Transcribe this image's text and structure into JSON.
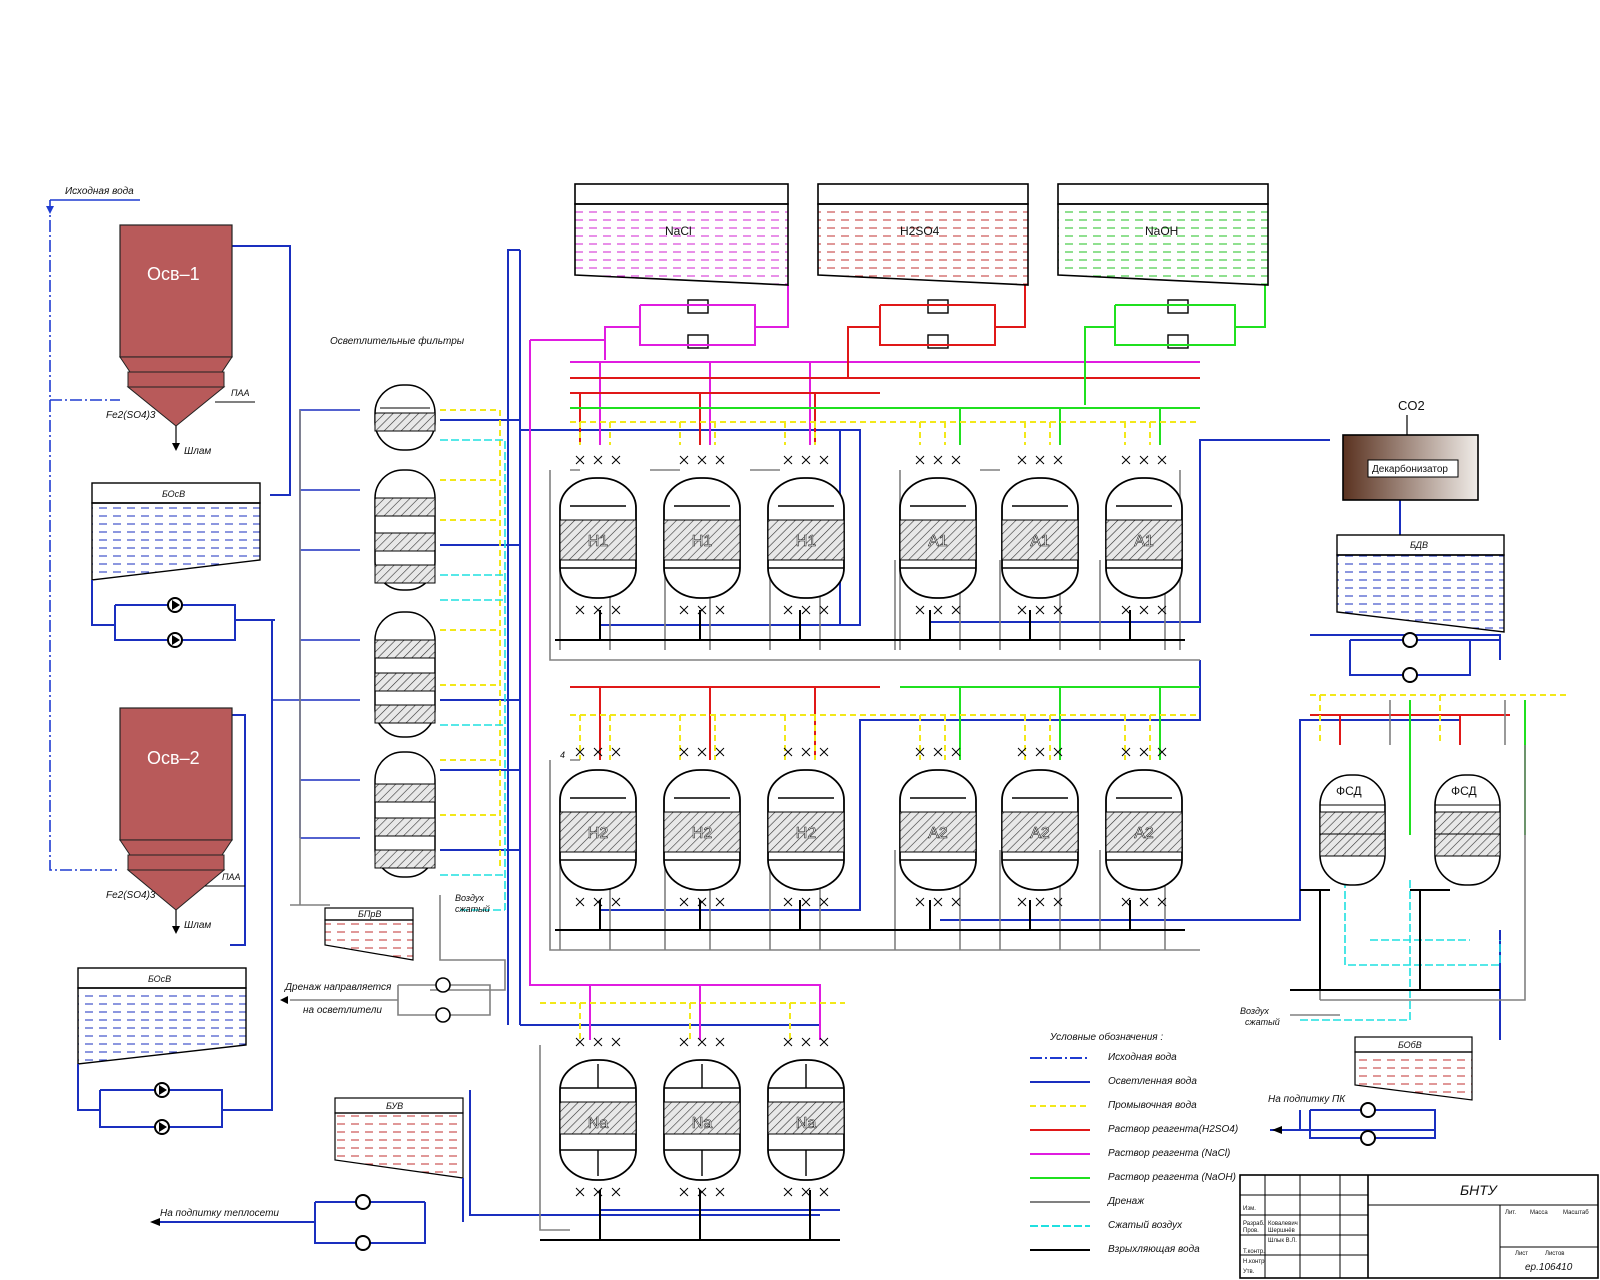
{
  "colors": {
    "source_water": "#1f3bd1",
    "clarified_water": "#1a2fbf",
    "wash_water": "#f2e81a",
    "reagent_h2so4": "#e01818",
    "reagent_nacl": "#e01ce0",
    "reagent_naoh": "#1fe01f",
    "drainage": "#808080",
    "compressed_air": "#1fe0e0",
    "loosening_water": "#000000",
    "clarifier_fill": "#b85a5a",
    "decarb_fill": "#6b4530"
  },
  "labels": {
    "source_water_top": "Исходная вода",
    "clarifier1": "Осв–1",
    "clarifier2": "Осв–2",
    "paa1": "ПАА",
    "paa2": "ПАА",
    "fe1": "Fe2(SO4)3",
    "fe2": "Fe2(SO4)3",
    "sludge1": "Шлам",
    "sludge2": "Шлам",
    "bosv1": "БОсВ",
    "bosv2": "БОсВ",
    "filters_title": "Осветлительные фильтры",
    "bprv": "БПрВ",
    "air1_line1": "Воздух",
    "air1_line2": "сжатый",
    "drain_line1": "Дренаж направляется",
    "drain_line2": "на осветлители",
    "buv": "БУВ",
    "to_heating": "На подпитку теплосети",
    "tank_nacl": "NaCl",
    "tank_h2so4": "H2SO4",
    "tank_naoh": "NaOH",
    "co2": "CO2",
    "decarb": "Декарбонизатор",
    "bdv": "БДВ",
    "fsd1": "ФСД",
    "fsd2": "ФСД",
    "air2_line1": "Воздух",
    "air2_line2": "сжатый",
    "bobv": "БОбВ",
    "to_pk": "На подпитку ПК",
    "v4": "4"
  },
  "vessels": {
    "row1": [
      "H1",
      "H1",
      "H1",
      "A1",
      "A1",
      "A1"
    ],
    "row2": [
      "H2",
      "H2",
      "H2",
      "A2",
      "A2",
      "A2"
    ],
    "row3": [
      "Na",
      "Na",
      "Na"
    ]
  },
  "legend": {
    "title": "Условные обозначения :",
    "items": [
      {
        "text": "Исходная вода",
        "color": "#1f3bd1",
        "dash": "12 3 2 3"
      },
      {
        "text": "Осветленная вода",
        "color": "#1a2fbf",
        "dash": ""
      },
      {
        "text": "Промывочная вода",
        "color": "#f2e81a",
        "dash": "6 4"
      },
      {
        "text": "Раствор реагента(H2SO4)",
        "color": "#e01818",
        "dash": ""
      },
      {
        "text": "Раствор реагента (NaCl)",
        "color": "#e01ce0",
        "dash": ""
      },
      {
        "text": "Раствор реагента (NaOH)",
        "color": "#1fe01f",
        "dash": ""
      },
      {
        "text": "Дренаж",
        "color": "#808080",
        "dash": ""
      },
      {
        "text": "Сжатый воздух",
        "color": "#1fe0e0",
        "dash": "8 3"
      },
      {
        "text": "Взрыхляющая вода",
        "color": "#000000",
        "dash": ""
      }
    ]
  },
  "title_block": {
    "org": "БНТУ",
    "code": "ер.106410",
    "small": [
      "Лит.",
      "Масса",
      "Масштаб",
      "Лист",
      "Листов"
    ],
    "rows": [
      "Изм.",
      "Разраб.",
      "Пров.",
      "Т.контр.",
      "Н.контр.",
      "Утв."
    ],
    "names": [
      "Ковалевич",
      "Шершнёв",
      "Шлык В.Л."
    ]
  }
}
